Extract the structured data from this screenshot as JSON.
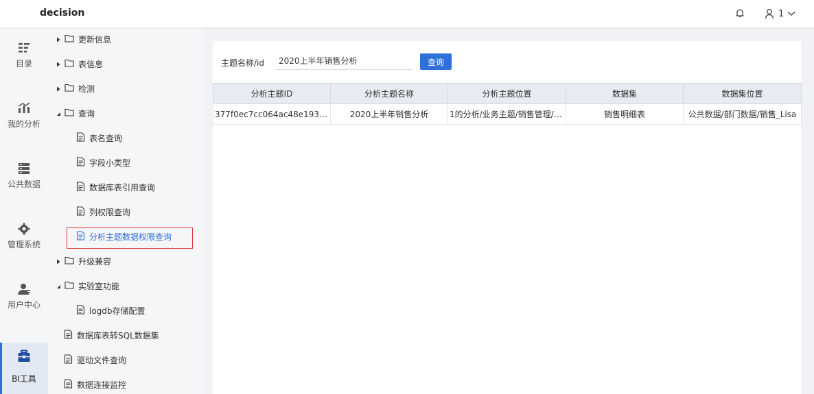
{
  "header": {
    "title": "decision",
    "user_name": "1"
  },
  "leftnav": [
    {
      "label": "目录",
      "icon": "catalog-icon"
    },
    {
      "label": "我的分析",
      "icon": "chart-icon"
    },
    {
      "label": "公共数据",
      "icon": "database-icon"
    },
    {
      "label": "管理系统",
      "icon": "gear-icon"
    },
    {
      "label": "用户中心",
      "icon": "user-icon"
    },
    {
      "label": "BI工具",
      "icon": "toolbox-icon"
    }
  ],
  "tree": {
    "n0": "更新信息",
    "n1": "表信息",
    "n2": "检测",
    "n3": "查询",
    "n3_c0": "表名查询",
    "n3_c1": "字段小类型",
    "n3_c2": "数据库表引用查询",
    "n3_c3": "列权限查询",
    "n3_c4": "分析主题数据权限查询",
    "n4": "升级兼容",
    "n5": "实验室功能",
    "n5_c0": "logdb存储配置",
    "n6": "数据库表转SQL数据集",
    "n7": "驱动文件查询",
    "n8": "数据连接监控"
  },
  "query": {
    "label": "主题名称/id",
    "value": "2020上半年销售分析",
    "button": "查询"
  },
  "table": {
    "headers": [
      "分析主题ID",
      "分析主题名称",
      "分析主题位置",
      "数据集",
      "数据集位置"
    ],
    "rows": [
      [
        "377f0ec7cc064ac48e1930c4…",
        "2020上半年销售分析",
        "1的分析/业务主题/销售管理/2…",
        "销售明细表",
        "公共数据/部门数据/销售_Lisa"
      ]
    ]
  }
}
